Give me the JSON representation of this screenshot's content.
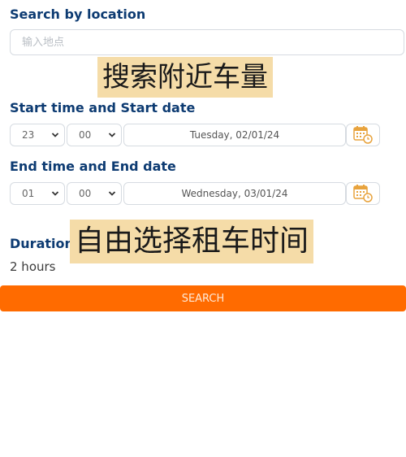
{
  "location": {
    "heading": "Search by location",
    "placeholder": "输入地点"
  },
  "overlays": {
    "search_nearby": "搜索附近车量",
    "choose_time": "自由选择租车时间"
  },
  "start": {
    "heading": "Start time and Start date",
    "hour": "23",
    "minute": "00",
    "date": "Tuesday, 02/01/24"
  },
  "end": {
    "heading": "End time and End date",
    "hour": "01",
    "minute": "00",
    "date": "Wednesday, 03/01/24"
  },
  "duration": {
    "heading": "Duration",
    "value": "2 hours"
  },
  "search_button": "SEARCH",
  "icons": {
    "calendar": "calendar-clock-icon",
    "dropdown": "chevron-down-icon"
  },
  "colors": {
    "heading": "#0d3b72",
    "accent": "#ff6b00",
    "overlay": "#f5dca8",
    "calendar": "#e8a33d"
  }
}
